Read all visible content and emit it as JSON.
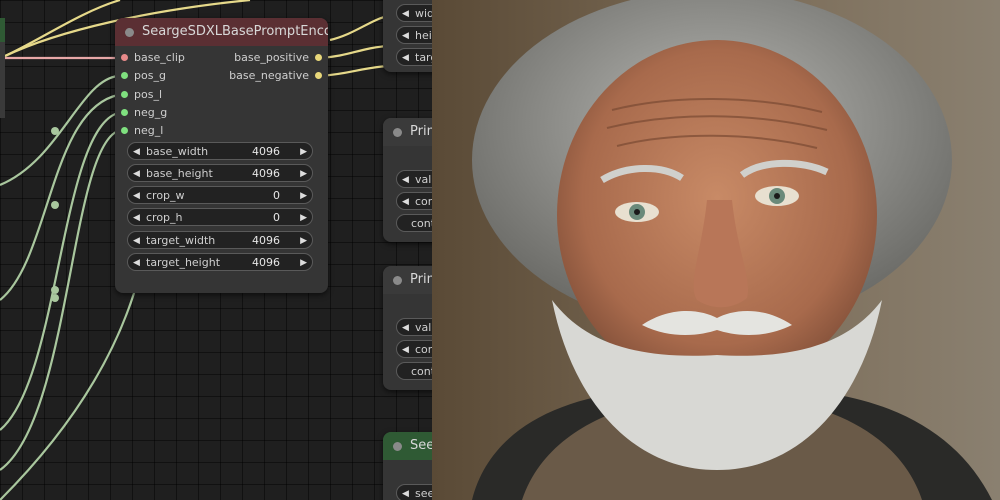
{
  "main_node": {
    "title": "SeargeSDXLBasePromptEncoder",
    "inputs": [
      {
        "label": "base_clip",
        "color": "#e88a8a"
      },
      {
        "label": "pos_g",
        "color": "#7fe07f"
      },
      {
        "label": "pos_l",
        "color": "#7fe07f"
      },
      {
        "label": "neg_g",
        "color": "#7fe07f"
      },
      {
        "label": "neg_l",
        "color": "#7fe07f"
      }
    ],
    "outputs": [
      {
        "label": "base_positive",
        "color": "#e8d77a"
      },
      {
        "label": "base_negative",
        "color": "#e8d77a"
      }
    ],
    "widgets": [
      {
        "label": "base_width",
        "value": "4096"
      },
      {
        "label": "base_height",
        "value": "4096"
      },
      {
        "label": "crop_w",
        "value": "0"
      },
      {
        "label": "crop_h",
        "value": "0"
      },
      {
        "label": "target_width",
        "value": "4096"
      },
      {
        "label": "target_height",
        "value": "4096"
      }
    ]
  },
  "right_nodes": {
    "top_widgets": [
      "wid",
      "heig",
      "targ"
    ],
    "primitive_1": {
      "title": "Prim",
      "widgets": [
        "valu",
        "con",
        "cont"
      ]
    },
    "primitive_2": {
      "title": "Prim",
      "widgets": [
        "valu",
        "con",
        "cont"
      ]
    },
    "seed_node": {
      "title": "See",
      "widgets": [
        "see"
      ]
    }
  },
  "colors": {
    "main_title_bar": "#5b2f33",
    "seed_title_bar": "#2f5a34",
    "wire_green": "#a9c79e",
    "wire_yellow": "#e6d98a",
    "wire_pink": "#e8a8a8"
  }
}
